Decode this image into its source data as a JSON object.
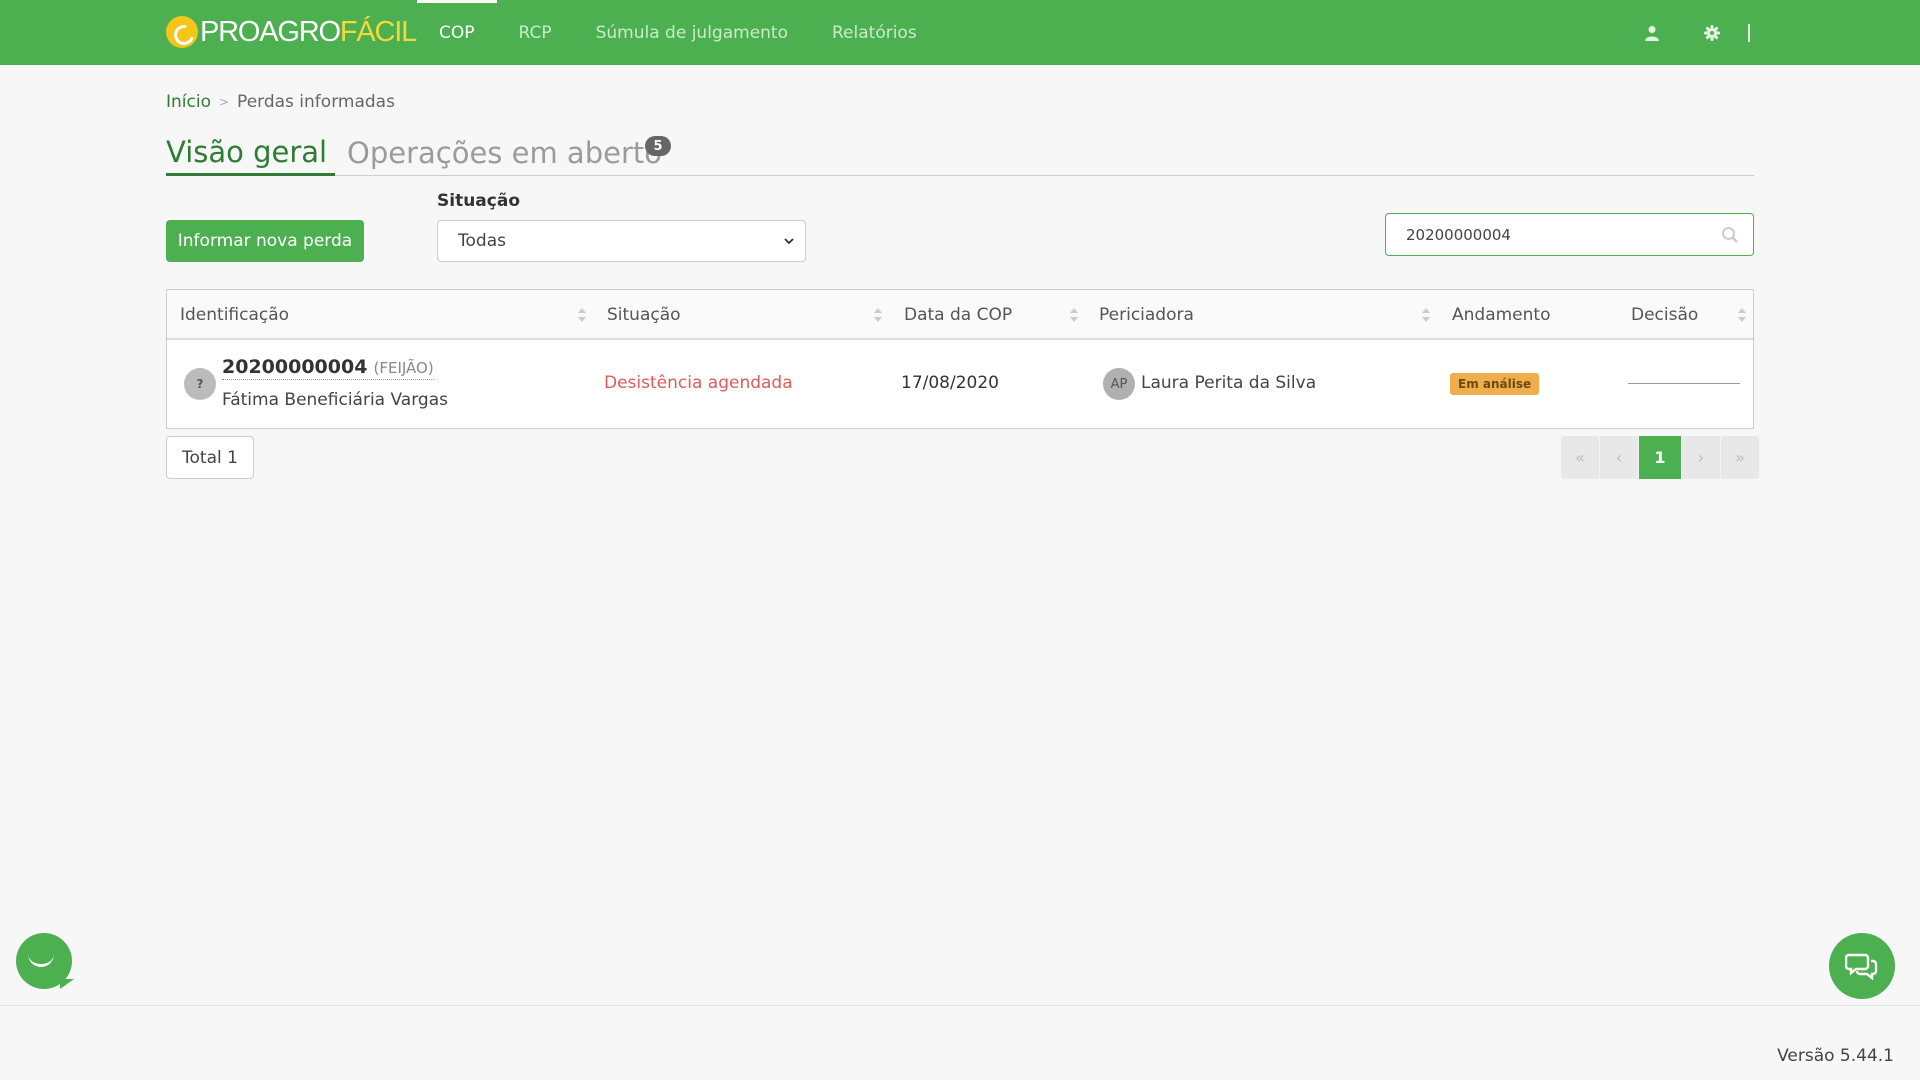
{
  "brand": {
    "part1": "PROAGRO",
    "part2": "FÁCIL",
    "colors": {
      "primary": "#4caf50",
      "accent": "#f5c518",
      "danger": "#e05a5a",
      "warning": "#f0ad4e"
    }
  },
  "nav": {
    "items": [
      {
        "label": "COP",
        "active": true
      },
      {
        "label": "RCP"
      },
      {
        "label": "Súmula de julgamento"
      },
      {
        "label": "Relatórios"
      }
    ],
    "icons": [
      "user-icon",
      "gear-icon"
    ]
  },
  "breadcrumb": {
    "home": "Início",
    "current": "Perdas informadas"
  },
  "tabs": [
    {
      "label": "Visão geral",
      "active": true
    },
    {
      "label": "Operações em aberto",
      "badge": "5"
    }
  ],
  "toolbar": {
    "new_loss_label": "Informar nova perda",
    "filter_label": "Situação",
    "filter_value": "Todas",
    "search_value": "20200000004"
  },
  "table": {
    "columns": [
      "Identificação",
      "Situação",
      "Data da COP",
      "Periciadora",
      "Andamento",
      "Decisão"
    ],
    "rows": [
      {
        "icon_text": "?",
        "id": "20200000004",
        "crop": "(FEIJÃO)",
        "beneficiary": "Fátima Beneficiária Vargas",
        "status": "Desistência agendada",
        "date": "17/08/2020",
        "expert_initials": "AP",
        "expert": "Laura Perita da Silva",
        "progress": "Em análise",
        "decision": ""
      }
    ]
  },
  "total_label": "Total 1",
  "pager": {
    "first": "«",
    "prev": "‹",
    "current": "1",
    "next": "›",
    "last": "»"
  },
  "footer": {
    "version": "Versão 5.44.1"
  }
}
